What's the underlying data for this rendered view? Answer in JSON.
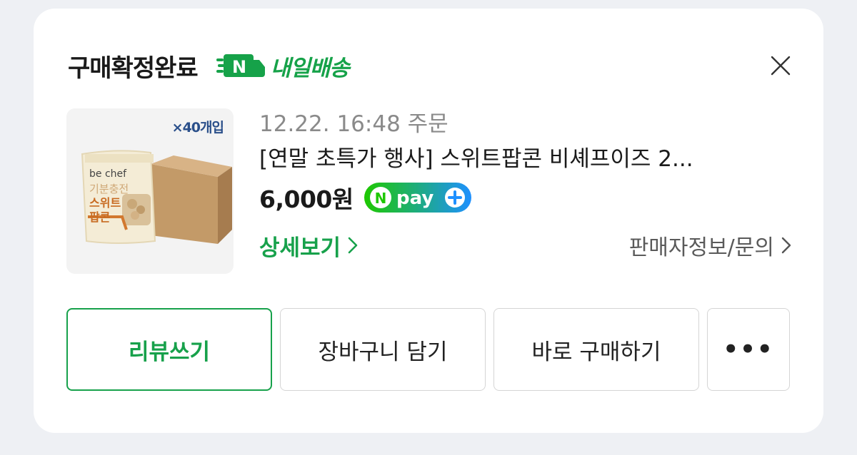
{
  "header": {
    "status": "구매확정완료",
    "delivery_label": "내일배송",
    "delivery_badge_letter": "N"
  },
  "product": {
    "thumbnail": {
      "badge": "×40개입",
      "brand": "be chef",
      "name_line1": "기분충전",
      "name_line2": "스위트",
      "name_line3": "팝콘"
    },
    "order_date": "12.22. 16:48 주문",
    "title": "[연말 초특가 행사] 스위트팝콘 비셰프이즈 2...",
    "price": "6,000원",
    "npay_label": "pay"
  },
  "links": {
    "detail": "상세보기",
    "seller": "판매자정보/문의"
  },
  "buttons": {
    "review": "리뷰쓰기",
    "cart": "장바구니 담기",
    "buy_now": "바로 구매하기",
    "more": "•••"
  },
  "colors": {
    "accent_green": "#17a14b",
    "npay_green": "#1ec800",
    "npay_blue": "#1e90ff",
    "card_background": "#ffffff",
    "page_background": "#eef0f4"
  }
}
